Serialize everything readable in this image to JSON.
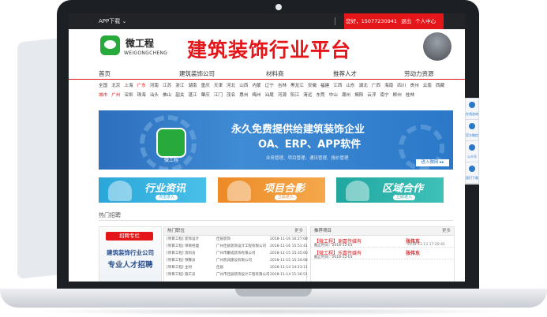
{
  "topbar": {
    "app_download": "APP下载 ⌄",
    "user_items": [
      "您好，15077230941",
      "退出",
      "个人中心"
    ]
  },
  "header": {
    "logo_cn": "微工程",
    "logo_en": "WEIGONGCHENG",
    "site_title": "建筑装饰行业平台"
  },
  "nav": {
    "items": [
      "首页",
      "建筑装饰公司",
      "材料商",
      "推荐人才",
      "劳动力资源"
    ]
  },
  "cities": {
    "row1": [
      "全国",
      "北京",
      "上海",
      "广东",
      "河南",
      "江苏",
      "浙江",
      "湖南",
      "重庆",
      "天津",
      "河北",
      "山西",
      "内蒙",
      "辽宁",
      "吉林",
      "黑龙江",
      "安徽",
      "福建",
      "江西",
      "山东",
      "湖北",
      "广西",
      "海南",
      "四川",
      "贵州",
      "云南",
      "西藏",
      "陕西",
      "甘肃",
      "更多"
    ],
    "row2": [
      "城市",
      "广州",
      "深圳",
      "珠海",
      "汕头",
      "佛山",
      "韶关",
      "湛江",
      "肇庆",
      "江门",
      "茂名",
      "惠州",
      "梅州",
      "汕尾",
      "河源",
      "阳江",
      "清远",
      "东莞",
      "中山",
      "潮州",
      "揭阳",
      "云浮",
      "南宁",
      "柳州",
      "桂林"
    ]
  },
  "banner": {
    "logo_caption": "微工程",
    "line1": "永久免费提供给建筑装饰企业",
    "line2": "OA、ERP、APP软件",
    "line3": "业务管理、项目管理、通讯管理、报价管理",
    "button": "进入微网 ▸▸"
  },
  "side_float": [
    "在线咨询",
    "官方微信",
    "公众号",
    "我们下载"
  ],
  "tiles": [
    {
      "title": "行业资讯",
      "sub": "点击进入"
    },
    {
      "title": "项目合影",
      "sub": "立即进入"
    },
    {
      "title": "区域合作",
      "sub": "立即进入"
    }
  ],
  "hot": {
    "section_label": "热门招聘",
    "promo_tag": "招聘专栏",
    "promo_line1": "建筑装饰行业公司",
    "promo_line2": "专业人才招聘",
    "panel1": {
      "title": "热门职位",
      "more": "更多",
      "rows": [
        {
          "job": "[项目工程] 装饰设计",
          "company": "佳居装饰",
          "date": "2018-11-16 16:27:08"
        },
        {
          "job": "[项目工程] 项目经理",
          "company": "广州佳居装饰设计工程有限公司",
          "date": "2018-11-16 15:51:41"
        },
        {
          "job": "[项目工程] 资料员",
          "company": "广州市聚成装饰有限公司",
          "date": "2018-11-15 15:35:00"
        },
        {
          "job": "[项目工程] 预算员",
          "company": "广州凯润建设有限公司",
          "date": "2018-11-15 15:34:08"
        },
        {
          "job": "[项目工程] 主材",
          "company": "佳居",
          "date": "2018-11-14 14:23:11"
        },
        {
          "job": "[项目工程] 施工员",
          "company": "广州市佳居装饰设计工程有限公司",
          "date": "2018-11-14 11:36:51"
        }
      ]
    },
    "panel2": {
      "title": "推荐项目",
      "more": "更多",
      "rows": [
        {
          "title": "【微工程】谢嘉传媒有",
          "name": "张伟东",
          "date": "截止时间：2018-12-01",
          "ts": "2018-11-13 17:20:42"
        },
        {
          "title": "【微工程】乐嘉传媒有",
          "name": "张伟东",
          "date": "截止时间：2018-12-01",
          "ts": ""
        }
      ]
    }
  }
}
